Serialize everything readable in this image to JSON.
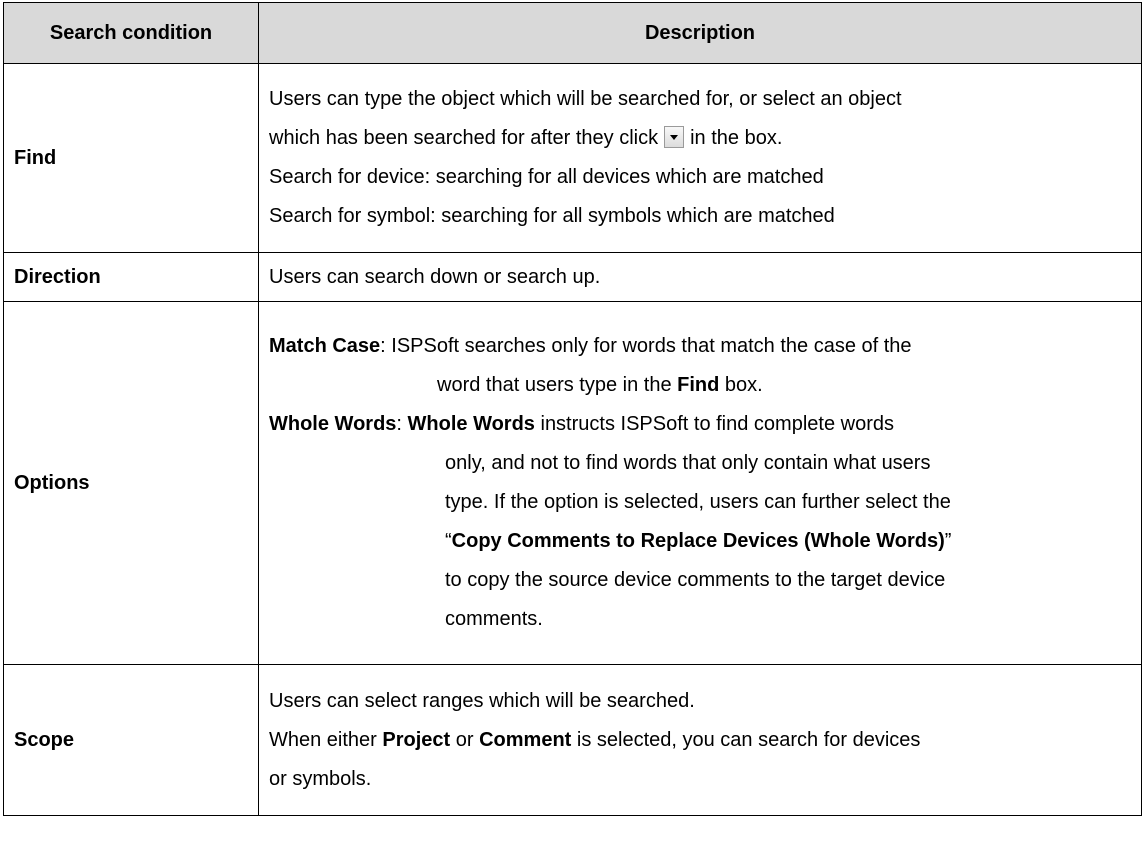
{
  "header": {
    "col1": "Search condition",
    "col2": "Description"
  },
  "rows": {
    "find": {
      "condition": "Find",
      "l1": "Users can type the object which will be searched for, or select an object",
      "l2a": "which has been searched for after they click",
      "dropdown_icon": "dropdown-arrow-icon",
      "l2b": "in the box.",
      "l3": "Search for device: searching for all devices which are matched",
      "l4": "Search for symbol: searching for all symbols which are matched"
    },
    "direction": {
      "condition": "Direction",
      "text": "Users can search down or search up."
    },
    "options": {
      "condition": "Options",
      "match_case_label": "Match Case",
      "match_case_text1": ": ISPSoft searches only for words that match the case of the",
      "match_case_text2a": "word that users type in the ",
      "match_case_find": "Find",
      "match_case_text2b": " box.",
      "whole_words_label": "Whole Words",
      "whole_words_sep": ": ",
      "whole_words_bold": "Whole Words",
      "whole_words_text1": " instructs ISPSoft to find complete words",
      "whole_words_l2": "only, and not to find words that only contain what users",
      "whole_words_l3": "type. If the option is selected, users can further select the",
      "whole_words_q_open": "“",
      "whole_words_copy": "Copy Comments to Replace Devices (Whole Words)",
      "whole_words_q_close": "”",
      "whole_words_l5": "to copy the source device comments to the target device",
      "whole_words_l6": "comments."
    },
    "scope": {
      "condition": "Scope",
      "l1": "Users can select ranges which will be searched.",
      "l2a": "When either ",
      "project": "Project",
      "l2b": " or ",
      "comment": "Comment",
      "l2c": " is selected, you can search for devices",
      "l3": "or symbols."
    }
  }
}
